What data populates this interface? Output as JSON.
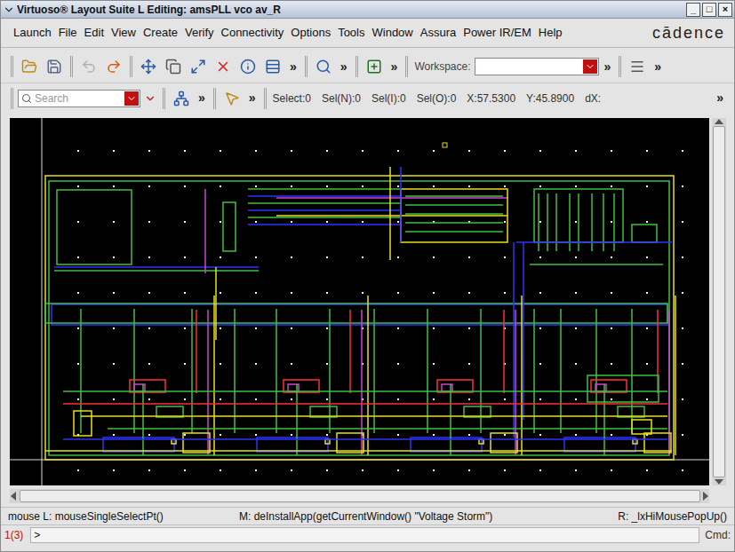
{
  "window": {
    "title": "Virtuoso® Layout Suite L Editing: amsPLL vco av_R",
    "controls": [
      "_",
      "□",
      "×"
    ]
  },
  "menu": [
    "Launch",
    "File",
    "Edit",
    "View",
    "Create",
    "Verify",
    "Connectivity",
    "Options",
    "Tools",
    "Window",
    "Assura",
    "Power IR/EM",
    "Help"
  ],
  "logo": "cādence",
  "toolbar": {
    "groups": [
      {
        "icons": [
          {
            "kind": "open",
            "disabled": false
          },
          {
            "kind": "save",
            "disabled": false
          }
        ],
        "more": ""
      },
      {
        "icons": [
          {
            "kind": "undo",
            "disabled": true
          },
          {
            "kind": "redo",
            "disabled": false
          }
        ],
        "more": ""
      },
      {
        "icons": [
          {
            "kind": "move",
            "disabled": false
          },
          {
            "kind": "copy",
            "disabled": false
          },
          {
            "kind": "stretch",
            "disabled": false
          },
          {
            "kind": "delete",
            "disabled": false
          },
          {
            "kind": "properties",
            "disabled": false
          },
          {
            "kind": "align",
            "disabled": false
          }
        ],
        "more": "»"
      },
      {
        "icons": [
          {
            "kind": "zoom",
            "disabled": false
          }
        ],
        "more": "»"
      },
      {
        "icons": [
          {
            "kind": "create",
            "disabled": false
          }
        ],
        "more": "»"
      }
    ],
    "workspace": {
      "label": "Workspace:",
      "value": "",
      "more": "»"
    },
    "end_group": {
      "icons": [
        {
          "kind": "menu",
          "disabled": false
        }
      ],
      "more": "»"
    }
  },
  "toolbar2": {
    "search": {
      "placeholder": "Search"
    },
    "groups": [
      {
        "icons": [
          {
            "kind": "hierarchy",
            "disabled": false
          }
        ],
        "more": "»"
      },
      {
        "icons": [
          {
            "kind": "select",
            "disabled": false
          }
        ],
        "more": "»"
      }
    ],
    "status": [
      "Select:0",
      "Sel(N):0",
      "Sel(I):0",
      "Sel(O):0",
      "X:57.5300",
      "Y:45.8900",
      "dX:"
    ],
    "more": "»"
  },
  "mouse": {
    "left": "mouse L: mouseSingleSelectPt()",
    "middle": "M: deInstallApp(getCurrentWindow() \"Voltage Storm\")",
    "right": "R: _lxHiMousePopUp()"
  },
  "command": {
    "count": "1(3)",
    "prompt": ">",
    "label": "Cmd:"
  }
}
